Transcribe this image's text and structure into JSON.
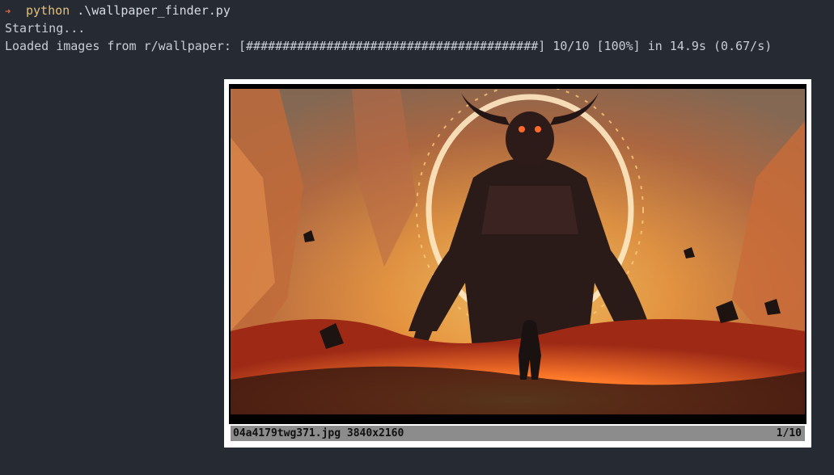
{
  "terminal": {
    "prompt_symbol": "➜",
    "command_program": "python",
    "command_argument": ".\\wallpaper_finder.py",
    "output_line_1": "Starting...",
    "progress_label": "Loaded images from r/wallpaper:",
    "progress_bar": "[########################################]",
    "progress_count": "10/10",
    "progress_percent": "[100%]",
    "progress_time": "in 14.9s (0.67/s)",
    "progress_fraction": 1.0
  },
  "viewer": {
    "image_subject": "demon-with-horns-and-knight-artwork",
    "filename": "04a4179twg371.jpg",
    "resolution": "3840x2160",
    "position": "1/10"
  },
  "colors": {
    "terminal_background": "#262b33",
    "prompt_arrow": "#e5694a",
    "python_keyword": "#e5c07b",
    "status_bar": "#8c8c8c"
  }
}
